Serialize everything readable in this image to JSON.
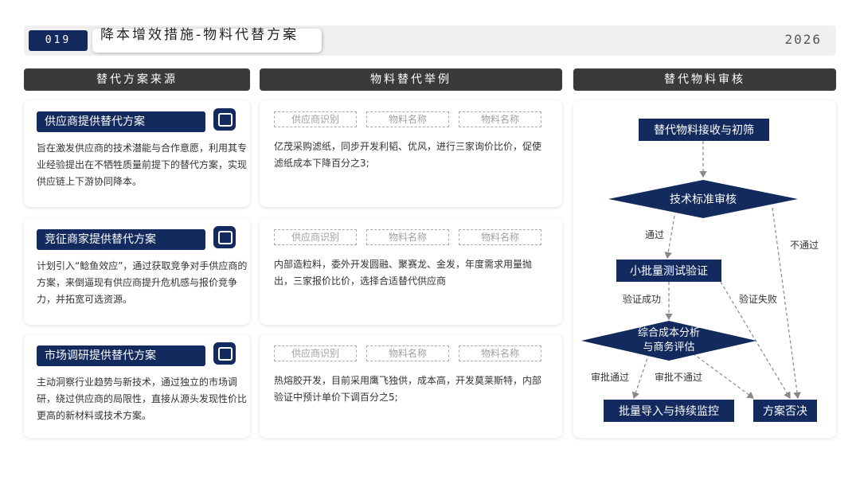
{
  "header": {
    "page_number": "019",
    "title": "降本增效措施-物料代替方案",
    "year": "2026"
  },
  "columns": {
    "sources": "替代方案来源",
    "examples": "物料替代举例",
    "review": "替代物料审核"
  },
  "sources": [
    {
      "title": "供应商提供替代方案",
      "desc": "旨在激发供应商的技术潜能与合作意愿，利用其专业经验提出在不牺牲质量前提下的替代方案，实现供应链上下游协同降本。",
      "icon": "chat-icon"
    },
    {
      "title": "竞征商家提供替代方案",
      "desc": "计划引入“鲶鱼效应”，通过获取竞争对手供应商的方案，来倒逼现有供应商提升危机感与报价竞争力，并拓宽可选资源。",
      "icon": "chat-icon"
    },
    {
      "title": "市场调研提供替代方案",
      "desc": "主动洞察行业趋势与新技术，通过独立的市场调研，绕过供应商的局限性，直接从源头发现性价比更高的新材料或技术方案。",
      "icon": "chat-icon"
    }
  ],
  "examples": [
    {
      "tags": [
        "供应商识别",
        "物料名称",
        "物料名称"
      ],
      "desc": "亿茂采购滤纸，同步开发利韬、优风，进行三家询价比价，促使滤纸成本下降百分之3;"
    },
    {
      "tags": [
        "供应商识别",
        "物料名称",
        "物料名称"
      ],
      "desc": "内部造粒料，委外开发圆融、聚赛龙、金发，年度需求用量抛出，三家报价比价，选择合适替代供应商"
    },
    {
      "tags": [
        "供应商识别",
        "物料名称",
        "物料名称"
      ],
      "desc": "热熔胶开发，目前采用鹰飞独供，成本高，开发莫莱斯特，内部验证中预计单价下调百分之5;"
    }
  ],
  "flow": {
    "step1": "替代物料接收与初筛",
    "step2": "技术标准审核",
    "step3": "小批量测试验证",
    "step4_line1": "综合成本分析",
    "step4_line2": "与商务评估",
    "step5": "批量导入与持续监控",
    "reject": "方案否决",
    "pass": "通过",
    "fail": "不通过",
    "verify_ok": "验证成功",
    "verify_fail": "验证失败",
    "approve": "审批通过",
    "disapprove": "审批不通过"
  },
  "colors": {
    "navy": "#132a5e",
    "dark_header": "#3a3a3a"
  }
}
